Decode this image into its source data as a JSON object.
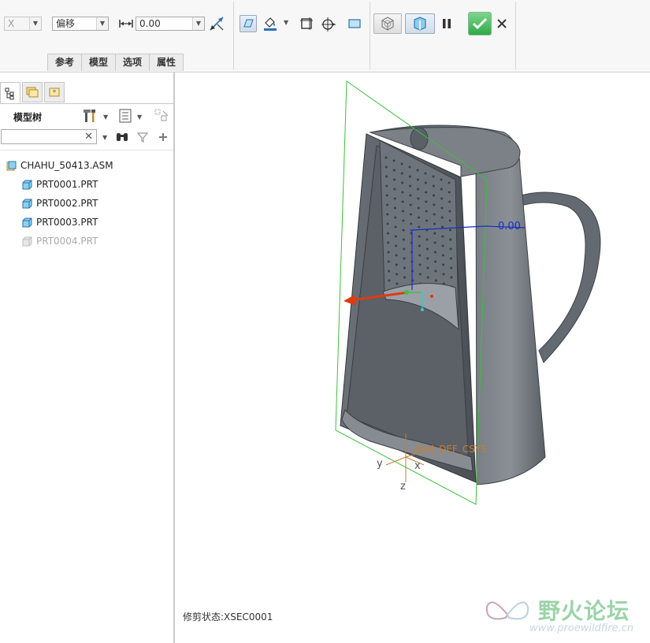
{
  "toolbar": {
    "axis_value": "X",
    "type_value": "偏移",
    "offset_value": "0.00",
    "tabs": [
      "参考",
      "模型",
      "选项",
      "属性"
    ]
  },
  "panel": {
    "title": "模型树",
    "search_placeholder": "",
    "tree": [
      {
        "label": "CHAHU_50413.ASM",
        "kind": "assembly",
        "dim": false
      },
      {
        "label": "PRT0001.PRT",
        "kind": "part",
        "dim": false
      },
      {
        "label": "PRT0002.PRT",
        "kind": "part",
        "dim": false
      },
      {
        "label": "PRT0003.PRT",
        "kind": "part",
        "dim": false
      },
      {
        "label": "PRT0004.PRT",
        "kind": "part",
        "dim": true
      }
    ]
  },
  "viewport": {
    "dimension_label": "0.00",
    "csys_label": "ASM_DEF_CSYS",
    "axis_x": "x",
    "axis_y": "y",
    "axis_z": "z"
  },
  "status": "修剪状态:XSEC0001",
  "watermark": {
    "name": "野火论坛",
    "url": "www.proewildfire.cn"
  },
  "colors": {
    "accent_green": "#2eab46",
    "plane_green": "#3cbf3c",
    "drag_arrow": "#e03a10",
    "dim_blue": "#1a2fc8",
    "model_gray": "#5f656c"
  }
}
